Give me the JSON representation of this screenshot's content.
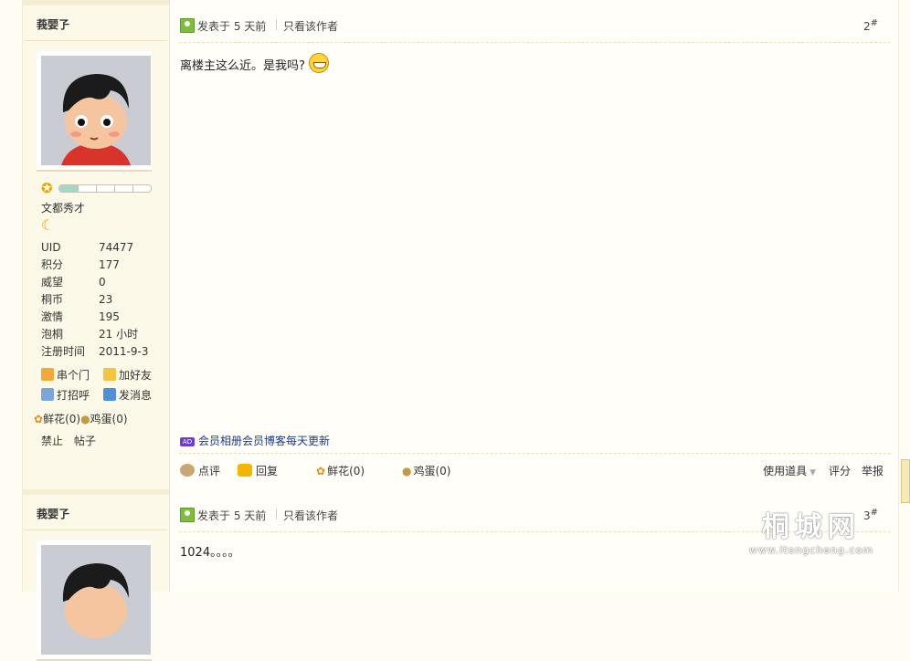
{
  "post1": {
    "author": "莪婯孒",
    "rank_title": "文都秀才",
    "rank_progress": 0.2,
    "stats": [
      {
        "k": "UID",
        "v": "74477"
      },
      {
        "k": "积分",
        "v": "177"
      },
      {
        "k": "威望",
        "v": "0"
      },
      {
        "k": "桐币",
        "v": "23"
      },
      {
        "k": "激情",
        "v": "195"
      },
      {
        "k": "泡桐",
        "v": "21 小时"
      },
      {
        "k": "注册时间",
        "v": "2011-9-3"
      }
    ],
    "links": {
      "visit": "串个门",
      "add_friend": "加好友",
      "greet": "打招呼",
      "message": "发消息"
    },
    "gifts": {
      "flower": "鲜花(0)",
      "egg": "鸡蛋(0)"
    },
    "ban": {
      "ban": "禁止",
      "posts": "帖子"
    },
    "posted": "发表于 5 天前",
    "only_author": "只看该作者",
    "floor": "2",
    "floor_mark": "#",
    "content": "离楼主这么近。是我吗?",
    "ad_badge": "AD",
    "ad_text": "会员相册会员博客每天更新",
    "footer": {
      "comment": "点评",
      "reply": "回复",
      "flower": "鲜花(0)",
      "egg": "鸡蛋(0)",
      "tools": "使用道具",
      "rate": "评分",
      "report": "举报"
    }
  },
  "post2": {
    "author": "莪婯孒",
    "posted": "发表于 5 天前",
    "only_author": "只看该作者",
    "floor": "3",
    "floor_mark": "#",
    "content": "1024。。。。"
  },
  "watermark": {
    "name": "桐城网",
    "url": "www.itongcheng.com"
  },
  "icons": [
    "star-rank-icon",
    "moon-icon",
    "home-icon",
    "handshake-icon",
    "greet-icon",
    "mail-icon",
    "flower-icon",
    "egg-icon",
    "post-icon",
    "smile-emoji",
    "comment-icon",
    "reply-icon"
  ]
}
